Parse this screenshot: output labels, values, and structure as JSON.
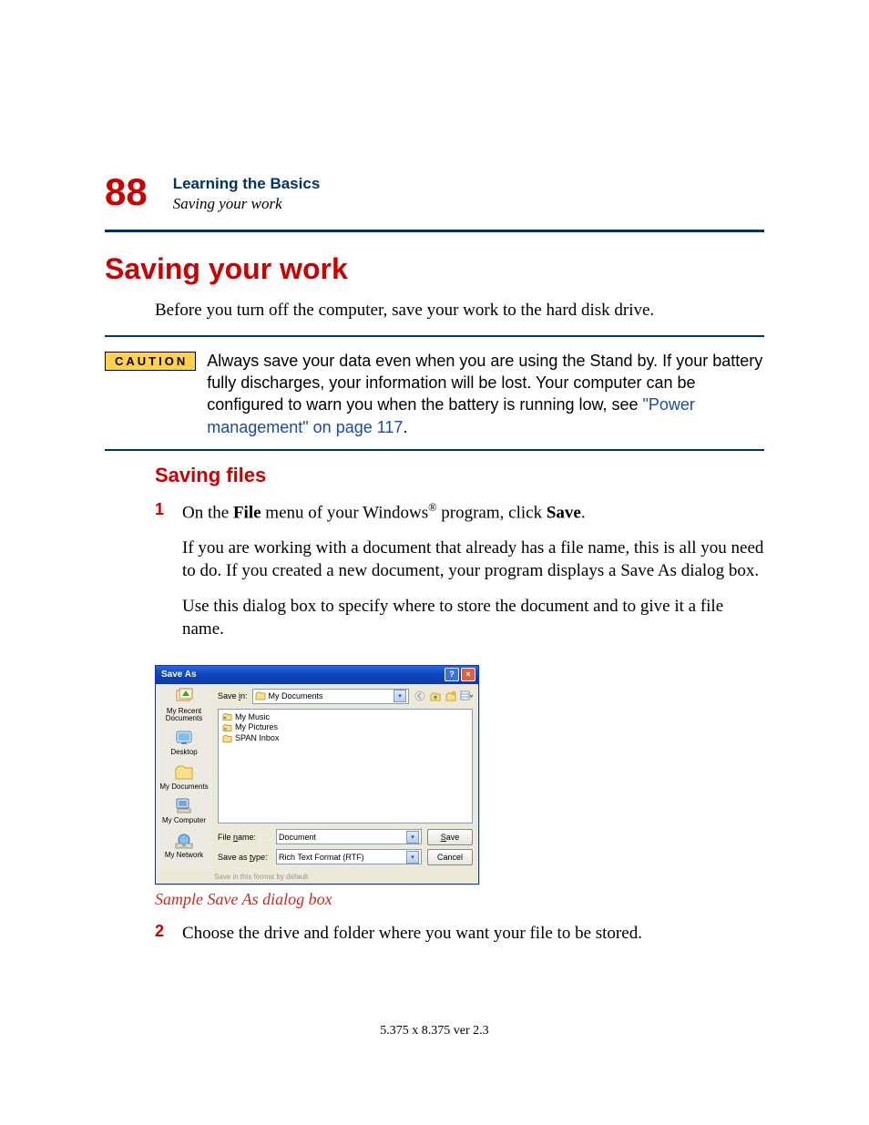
{
  "page_number": "88",
  "chapter_title": "Learning the Basics",
  "running_head": "Saving your work",
  "section_title": "Saving your work",
  "intro_text": "Before you turn off the computer, save your work to the hard disk drive.",
  "caution": {
    "label": "CAUTION",
    "text_before_link": "Always save your data even when you are using the Stand by. If your battery fully discharges, your information will be lost. Your computer can be configured to warn you when the battery is running low, see ",
    "link_text": "\"Power management\" on page 117",
    "text_after_link": "."
  },
  "subsection_title": "Saving files",
  "step1": {
    "num": "1",
    "p1_a": "On the ",
    "p1_file": "File",
    "p1_b": " menu of your Windows",
    "p1_reg": "®",
    "p1_c": " program, click ",
    "p1_save": "Save",
    "p1_d": ".",
    "p2": "If you are working with a document that already has a file name, this is all you need to do. If you created a new document, your program displays a Save As dialog box.",
    "p3": "Use this dialog box to specify where to store the document and to give it a file name."
  },
  "dialog": {
    "title": "Save As",
    "save_in_underline": "i",
    "save_in_label_pre": "Save ",
    "save_in_label_post": "n:",
    "save_in_value": "My Documents",
    "files": [
      "My Music",
      "My Pictures",
      "SPAN Inbox"
    ],
    "places": [
      "My Recent Documents",
      "Desktop",
      "My Documents",
      "My Computer",
      "My Network"
    ],
    "file_name_underline": "n",
    "file_name_label_pre": "File ",
    "file_name_label_post": "ame:",
    "file_name_value": "Document",
    "save_as_type_underline": "t",
    "save_as_type_label_pre": "Save as ",
    "save_as_type_label_post": "ype:",
    "save_as_type_value": "Rich Text Format (RTF)",
    "save_btn_underline": "S",
    "save_btn_rest": "ave",
    "cancel_btn": "Cancel",
    "save_default_text": "Save in this format by default"
  },
  "figure_caption": "Sample Save As dialog box",
  "step2": {
    "num": "2",
    "text": "Choose the drive and folder where you want your file to be stored."
  },
  "footer": "5.375 x 8.375 ver 2.3"
}
